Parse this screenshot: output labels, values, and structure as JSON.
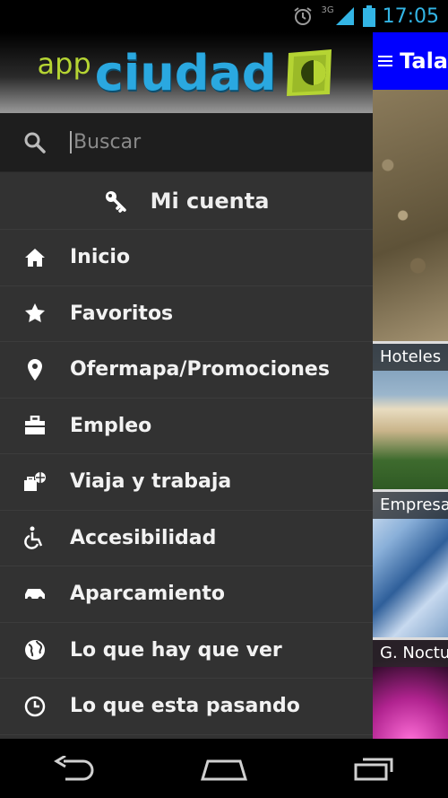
{
  "status_bar": {
    "time": "17:05",
    "network": "3G"
  },
  "drawer": {
    "logo": {
      "app": "app",
      "ciudad": "ciudad"
    },
    "search": {
      "placeholder": "Buscar"
    },
    "account_label": "Mi cuenta",
    "items": [
      {
        "label": "Inicio",
        "icon": "home-icon"
      },
      {
        "label": "Favoritos",
        "icon": "star-icon"
      },
      {
        "label": "Ofermapa/Promociones",
        "icon": "location-pin-icon"
      },
      {
        "label": "Empleo",
        "icon": "briefcase-icon"
      },
      {
        "label": "Viaja y trabaja",
        "icon": "travel-icon"
      },
      {
        "label": "Accesibilidad",
        "icon": "wheelchair-icon"
      },
      {
        "label": "Aparcamiento",
        "icon": "car-icon"
      },
      {
        "label": "Lo que hay que ver",
        "icon": "globe-icon"
      },
      {
        "label": "Lo que esta pasando",
        "icon": "clock-icon"
      }
    ]
  },
  "content": {
    "title": "Tala",
    "tiles": [
      {
        "label": "Hoteles"
      },
      {
        "label": "Empresas"
      },
      {
        "label": "G. Nocturna"
      }
    ]
  },
  "colors": {
    "accent": "#33b5e5",
    "topbar": "#0000ff",
    "drawer_bg": "#323232",
    "logo_green": "#b5d433",
    "logo_blue": "#2aa8e0"
  }
}
